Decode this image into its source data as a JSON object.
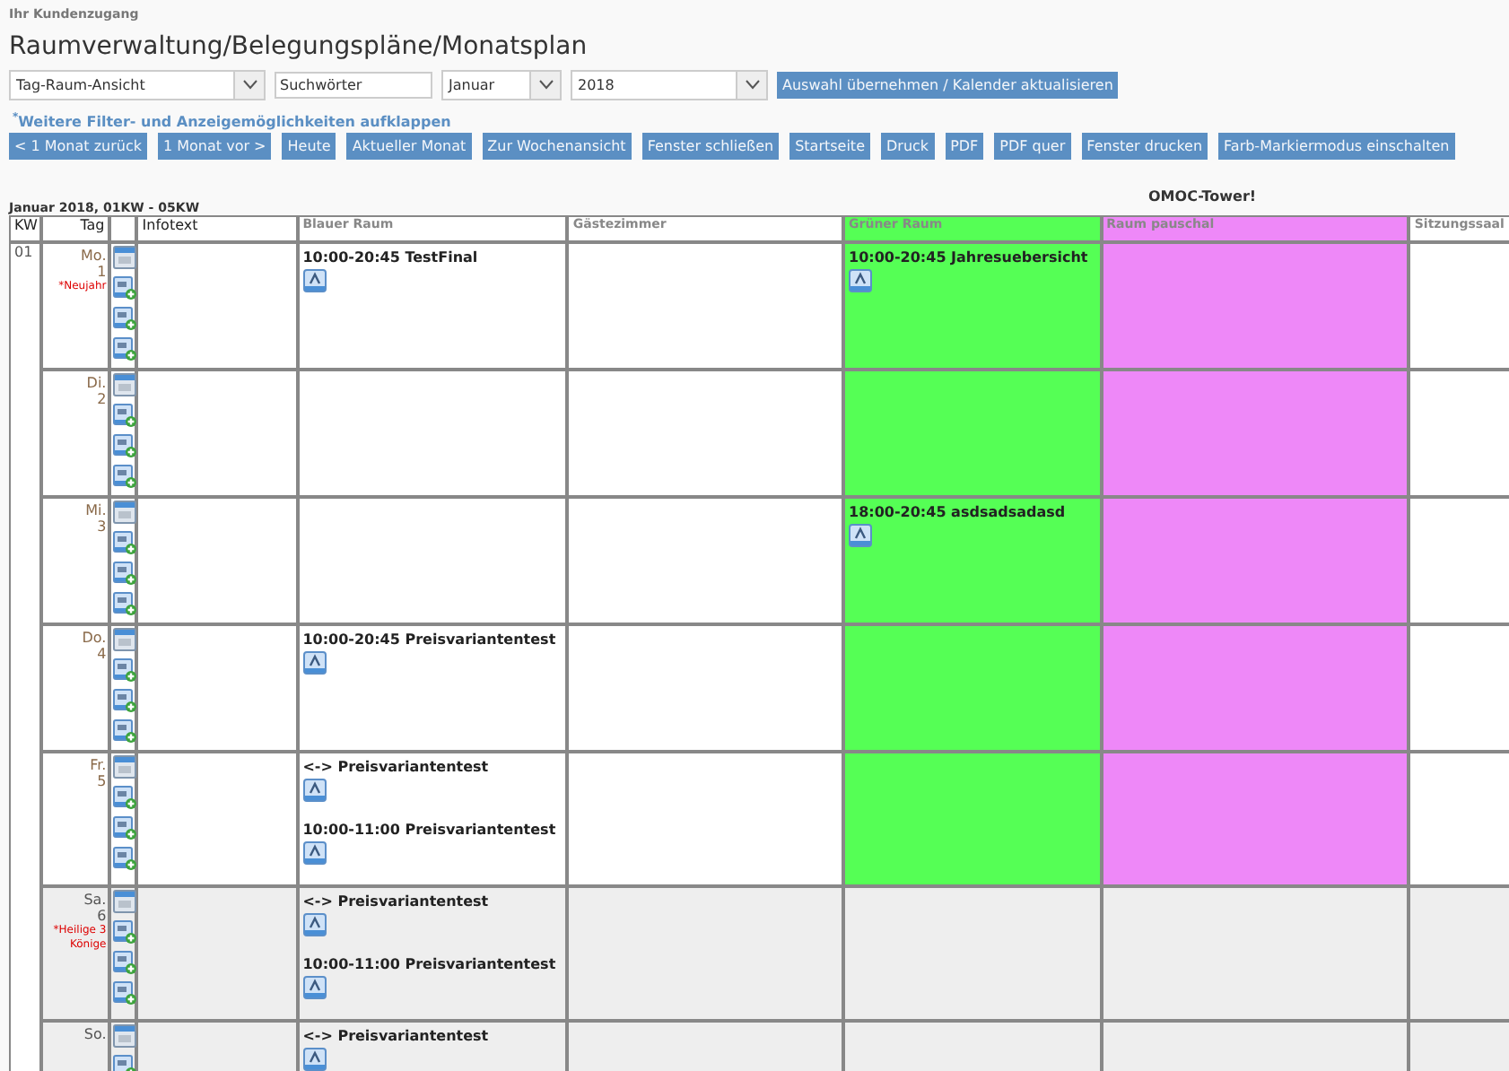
{
  "account_label": "Ihr Kundenzugang",
  "title": "Raumverwaltung/Belegungspläne/Monatsplan",
  "filters": [
    {
      "kind": "select",
      "value": "Tag-Raum-Ansicht"
    },
    {
      "kind": "input",
      "value": "Suchwörter"
    },
    {
      "kind": "select",
      "value": "Januar"
    },
    {
      "kind": "select",
      "value": "2018"
    }
  ],
  "apply_button": "Auswahl übernehmen / Kalender aktualisieren",
  "expand_link": {
    "marker": "*",
    "text": "Weitere Filter- und Anzeigemöglichkeiten aufklappen"
  },
  "buttons": [
    "< 1 Monat zurück",
    "1 Monat vor >",
    "Heute",
    "Aktueller Monat",
    "Zur Wochenansicht",
    "Fenster schließen",
    "Startseite",
    "Druck",
    "PDF",
    "PDF quer",
    "Fenster drucken",
    "Farb-Markiermodus einschalten"
  ],
  "range_label": "Januar 2018, 01KW - 05KW",
  "building": "OMOC-Tower!",
  "table": {
    "columns": {
      "week": "KW",
      "day": "Tag",
      "info": "Infotext"
    },
    "rooms": [
      {
        "name": "Blauer Raum"
      },
      {
        "name": "Gästezimmer"
      },
      {
        "name": "Grüner Raum",
        "color": "#55ff55"
      },
      {
        "name": "Raum pauschal",
        "color": "#ee88f8"
      },
      {
        "name": "Sitzungssaal"
      }
    ],
    "rows": [
      {
        "week": "01",
        "day": "Mo.",
        "date": "1",
        "holiday": "*Neujahr",
        "weekend": false,
        "cells": [
          [
            "10:00-20:45 TestFinal"
          ],
          [],
          [
            "10:00-20:45 Jahresuebersicht"
          ],
          [],
          []
        ]
      },
      {
        "day": "Di.",
        "date": "2",
        "weekend": false,
        "cells": [
          [],
          [],
          [],
          [],
          []
        ]
      },
      {
        "day": "Mi.",
        "date": "3",
        "weekend": false,
        "cells": [
          [],
          [],
          [
            "18:00-20:45 asdsadsadasd"
          ],
          [],
          []
        ]
      },
      {
        "day": "Do.",
        "date": "4",
        "weekend": false,
        "cells": [
          [
            "10:00-20:45 Preisvariantentest"
          ],
          [],
          [],
          [],
          []
        ]
      },
      {
        "day": "Fr.",
        "date": "5",
        "weekend": false,
        "cells": [
          [
            "<-> Preisvariantentest",
            "10:00-11:00 Preisvariantentest"
          ],
          [],
          [],
          [],
          []
        ]
      },
      {
        "day": "Sa.",
        "date": "6",
        "holiday": "*Heilige 3 Könige",
        "weekend": true,
        "cells": [
          [
            "<-> Preisvariantentest",
            "10:00-11:00 Preisvariantentest"
          ],
          [],
          [],
          [],
          []
        ]
      },
      {
        "day": "So.",
        "weekend": true,
        "cells": [
          [
            "<-> Preisvariantentest"
          ],
          [],
          [],
          [],
          []
        ]
      }
    ]
  }
}
